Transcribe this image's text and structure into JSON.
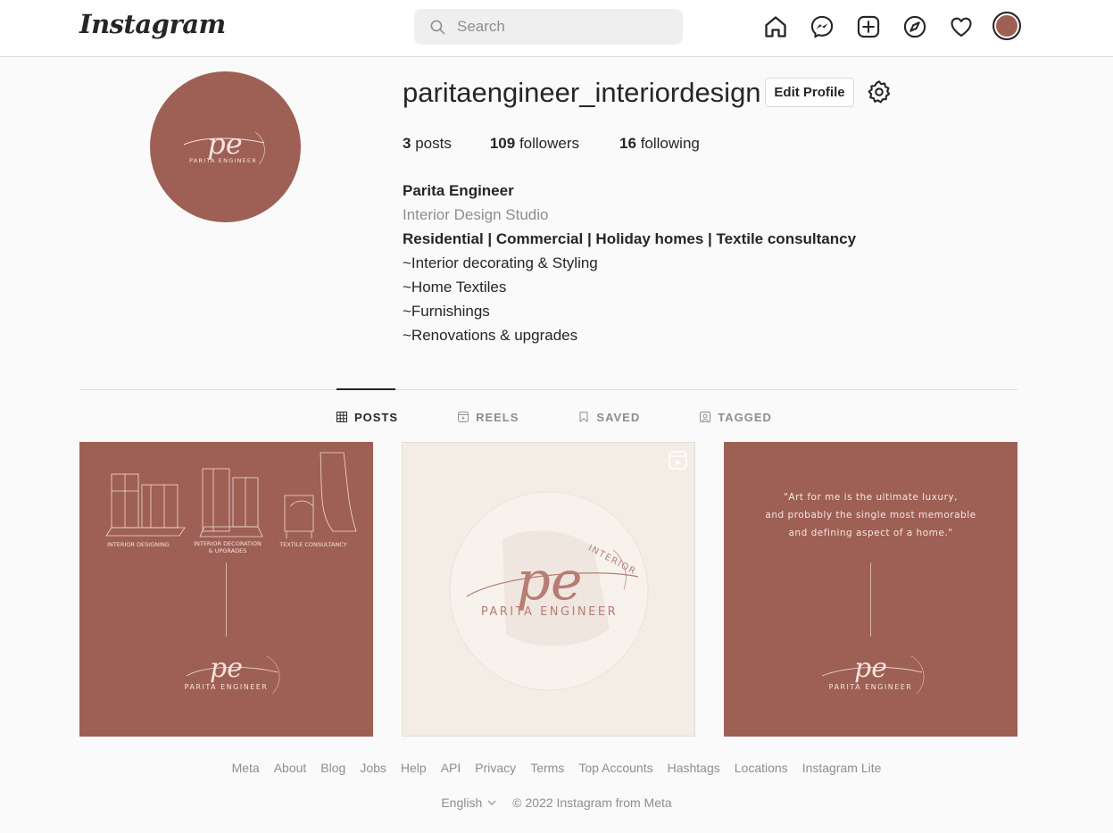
{
  "header": {
    "logo_text": "Instagram",
    "search_placeholder": "Search",
    "icons": [
      "home-icon",
      "messenger-icon",
      "new-post-icon",
      "explore-icon",
      "activity-heart-icon",
      "profile-avatar"
    ]
  },
  "profile": {
    "username": "paritaengineer_interiordesign",
    "edit_label": "Edit Profile",
    "stats": {
      "posts_count": "3",
      "posts_label": "posts",
      "followers_count": "109",
      "followers_label": "followers",
      "following_count": "16",
      "following_label": "following"
    },
    "bio": {
      "name": "Parita Engineer",
      "category": "Interior Design Studio",
      "line1": "Residential | Commercial | Holiday homes | Textile consultancy",
      "line2": "~Interior decorating & Styling",
      "line3": "~Home Textiles",
      "line4": "~Furnishings",
      "line5": "~Renovations & upgrades"
    },
    "logo": {
      "monogram": "pe",
      "brand": "PARITA ENGINEER",
      "arc": "INTERIOR"
    }
  },
  "tabs": [
    {
      "label": "POSTS",
      "active": true
    },
    {
      "label": "REELS",
      "active": false
    },
    {
      "label": "SAVED",
      "active": false
    },
    {
      "label": "TAGGED",
      "active": false
    }
  ],
  "posts": {
    "post1": {
      "captions": [
        "INTERIOR DESIGNING",
        "INTERIOR DECORATION",
        "& UPGRADES",
        "TEXTILE CONSULTANCY"
      ]
    },
    "post3": {
      "quote_line1": "\"Art for me is the ultimate luxury,",
      "quote_line2": "and probably the single most memorable",
      "quote_line3": "and defining aspect of a home.\""
    }
  },
  "footer": {
    "links": [
      "Meta",
      "About",
      "Blog",
      "Jobs",
      "Help",
      "API",
      "Privacy",
      "Terms",
      "Top Accounts",
      "Hashtags",
      "Locations",
      "Instagram Lite"
    ],
    "language": "English",
    "copyright": "© 2022 Instagram from Meta"
  },
  "colors": {
    "brand_rose": "#9e5f55",
    "cream": "#f3ede6",
    "text": "#262626",
    "muted": "#8e8e8e",
    "border": "#dbdbdb"
  }
}
